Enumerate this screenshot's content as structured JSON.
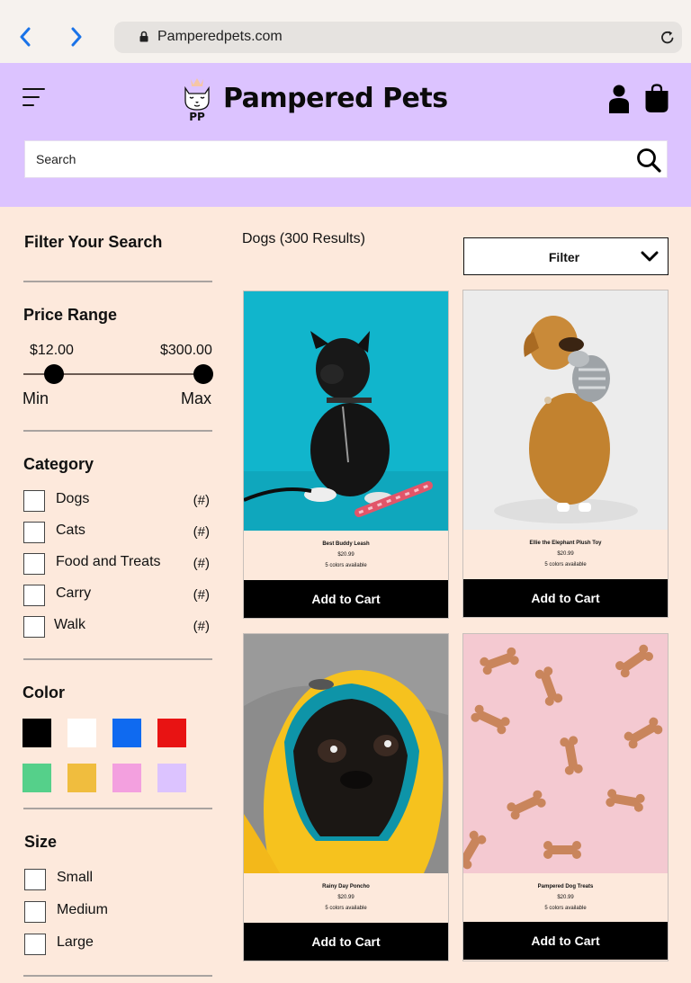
{
  "browser": {
    "url": "Pamperedpets.com"
  },
  "header": {
    "brand": "Pampered Pets",
    "logo_monogram": "PP",
    "search_placeholder": "Search",
    "colors": {
      "header_bg": "#dcc3ff",
      "page_bg": "#fde9dc"
    }
  },
  "sidebar": {
    "filter_title": "Filter Your Search",
    "price": {
      "title": "Price Range",
      "min_value": "$12.00",
      "max_value": "$300.00",
      "min_label": "Min",
      "max_label": "Max"
    },
    "category": {
      "title": "Category",
      "items": [
        {
          "label": "Dogs",
          "count": "(#)"
        },
        {
          "label": "Cats",
          "count": "(#)"
        },
        {
          "label": "Food and Treats",
          "count": "(#)"
        },
        {
          "label": "Carry",
          "count": "(#)"
        },
        {
          "label": "Walk",
          "count": "(#)"
        }
      ]
    },
    "color": {
      "title": "Color",
      "swatches": [
        "#000000",
        "#ffffff",
        "#0f6af0",
        "#e81313",
        "#55d08a",
        "#f0bd3e",
        "#f3a0df",
        "#dcc3ff"
      ]
    },
    "size": {
      "title": "Size",
      "items": [
        "Small",
        "Medium",
        "Large"
      ]
    }
  },
  "main": {
    "results_title": "Dogs (300 Results)",
    "filter_label": "Filter",
    "products": [
      {
        "name": "Best Buddy Leash",
        "price": "$20.99",
        "colors": "5 colors available",
        "cta": "Add to Cart"
      },
      {
        "name": "Ellie the Elephant Plush Toy",
        "price": "$20.99",
        "colors": "5 colors available",
        "cta": "Add to Cart"
      },
      {
        "name": "Rainy Day Poncho",
        "price": "$20.99",
        "colors": "5 colors available",
        "cta": "Add to Cart"
      },
      {
        "name": "Pampered Dog Treats",
        "price": "$20.99",
        "colors": "5 colors available",
        "cta": "Add to Cart"
      }
    ]
  }
}
